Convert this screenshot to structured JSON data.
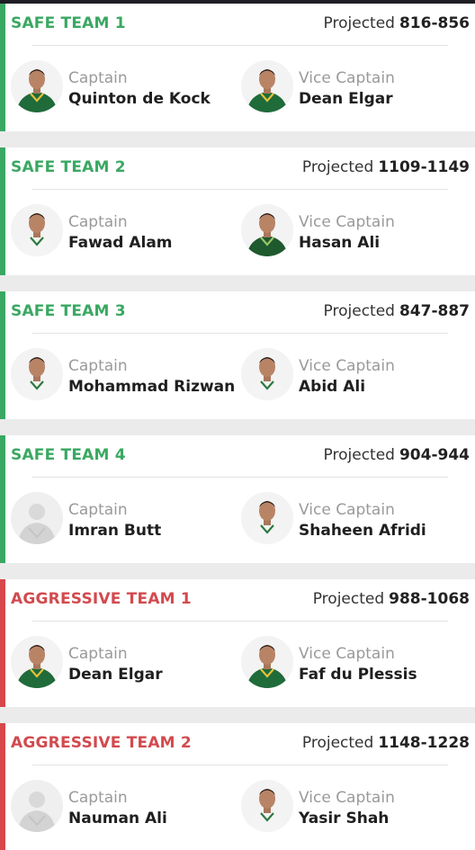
{
  "colors": {
    "safe": "#3aa862",
    "aggressive": "#d7474c",
    "sa_green": "#1f6b3a",
    "pk_kit": "#f4f4f4"
  },
  "projected_label": "Projected",
  "captain_label": "Captain",
  "vice_captain_label": "Vice Captain",
  "teams": [
    {
      "title": "SAFE TEAM 1",
      "type": "safe",
      "range": "816-856",
      "captain": {
        "name": "Quinton de Kock",
        "avatar": "sa-player-icon"
      },
      "vice": {
        "name": "Dean Elgar",
        "avatar": "sa-player-icon"
      }
    },
    {
      "title": "SAFE TEAM 2",
      "type": "safe",
      "range": "1109-1149",
      "captain": {
        "name": "Fawad Alam",
        "avatar": "pk-player-icon"
      },
      "vice": {
        "name": "Hasan Ali",
        "avatar": "pk-player-green-icon"
      }
    },
    {
      "title": "SAFE TEAM 3",
      "type": "safe",
      "range": "847-887",
      "captain": {
        "name": "Mohammad Rizwan",
        "avatar": "pk-player-icon"
      },
      "vice": {
        "name": "Abid Ali",
        "avatar": "pk-player-icon"
      }
    },
    {
      "title": "SAFE TEAM 4",
      "type": "safe",
      "range": "904-944",
      "captain": {
        "name": "Imran Butt",
        "avatar": "placeholder-player-icon"
      },
      "vice": {
        "name": "Shaheen Afridi",
        "avatar": "pk-player-icon"
      }
    },
    {
      "title": "AGGRESSIVE TEAM 1",
      "type": "aggressive",
      "range": "988-1068",
      "captain": {
        "name": "Dean Elgar",
        "avatar": "sa-player-icon"
      },
      "vice": {
        "name": "Faf du Plessis",
        "avatar": "sa-player-icon"
      }
    },
    {
      "title": "AGGRESSIVE TEAM 2",
      "type": "aggressive",
      "range": "1148-1228",
      "captain": {
        "name": "Nauman Ali",
        "avatar": "placeholder-player-icon"
      },
      "vice": {
        "name": "Yasir Shah",
        "avatar": "pk-player-icon"
      }
    }
  ]
}
